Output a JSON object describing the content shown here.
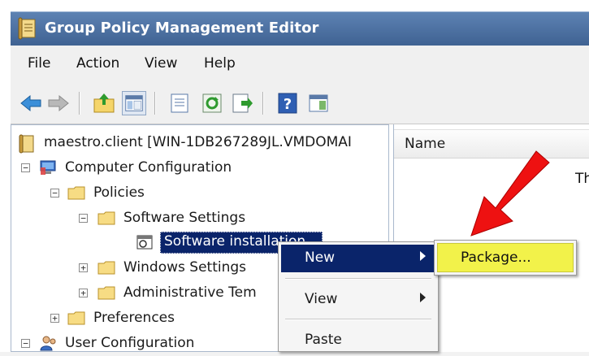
{
  "window": {
    "title": "Group Policy Management Editor"
  },
  "menu": [
    "File",
    "Action",
    "View",
    "Help"
  ],
  "toolbar": [
    {
      "icon": "back-arrow-icon"
    },
    {
      "icon": "forward-arrow-icon"
    },
    {
      "icon": "up-folder-icon"
    },
    {
      "icon": "show-hide-tree-icon"
    },
    {
      "icon": "properties-icon"
    },
    {
      "icon": "refresh-icon"
    },
    {
      "icon": "export-list-icon"
    },
    {
      "icon": "help-icon"
    },
    {
      "icon": "show-hide-action-pane-icon"
    }
  ],
  "tree": {
    "root": "maestro.client [WIN-1DB267289JL.VMDOMAI",
    "computer_configuration": "Computer Configuration",
    "policies": "Policies",
    "software_settings": "Software Settings",
    "software_installation": "Software installation",
    "windows_settings": "Windows Settings",
    "administrative_templates": "Administrative Tem",
    "preferences": "Preferences",
    "user_configuration": "User Configuration"
  },
  "rightpane": {
    "column_name": "Name",
    "truncated_text": "Th"
  },
  "context_menu": {
    "new": "New",
    "view": "View",
    "paste": "Paste"
  },
  "submenu": {
    "package": "Package..."
  },
  "colors": {
    "titlebar": "#4a6fa0",
    "highlight": "#0a246a",
    "package_highlight": "#f2f24a",
    "arrow": "#ee1111"
  }
}
